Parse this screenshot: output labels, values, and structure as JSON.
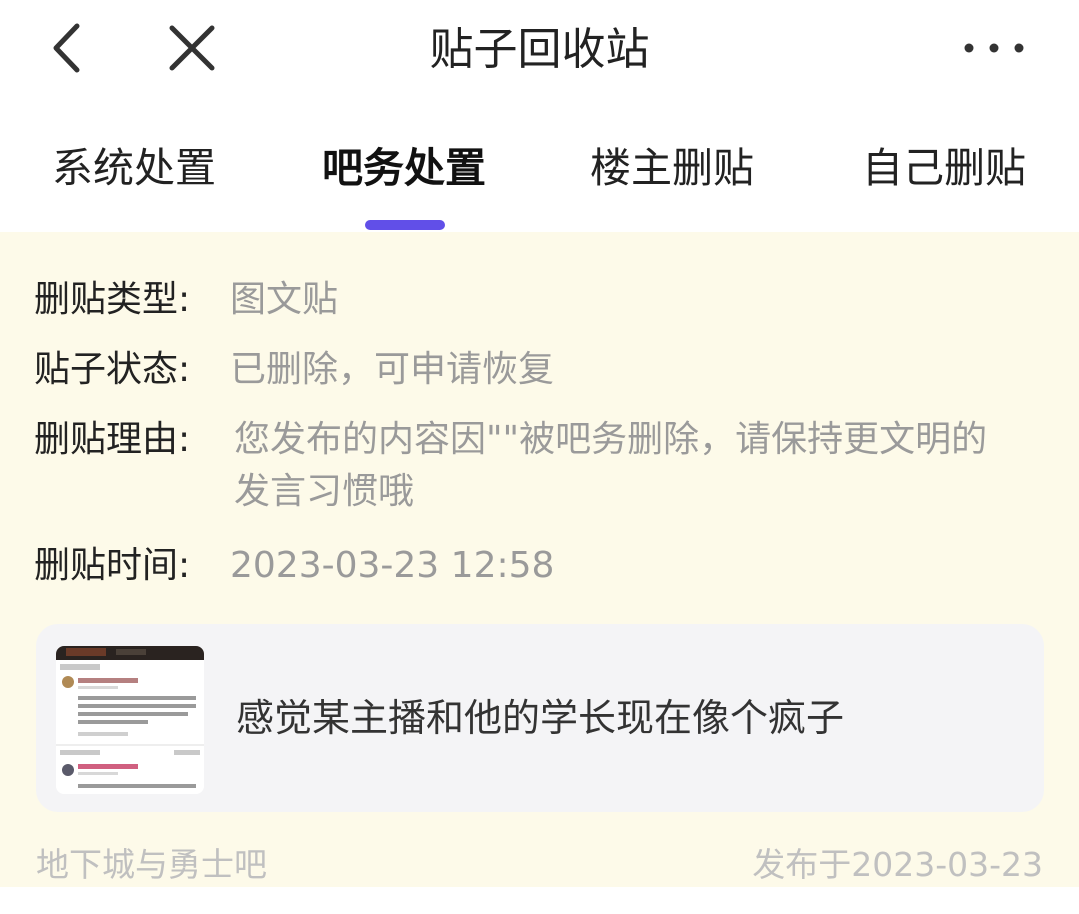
{
  "header": {
    "title": "贴子回收站",
    "back_icon": "chevron-left-icon",
    "close_icon": "close-icon",
    "more_icon": "more-dots-icon"
  },
  "tabs": [
    {
      "label": "系统处置"
    },
    {
      "label": "吧务处置"
    },
    {
      "label": "楼主删贴"
    },
    {
      "label": "自己删贴"
    }
  ],
  "active_tab": "吧务处置",
  "accent_color": "#614fe8",
  "details": {
    "type_label": "删贴类型:",
    "type_value": "图文贴",
    "status_label": "贴子状态:",
    "status_value": "已删除，可申请恢复",
    "reason_label": "删贴理由:",
    "reason_value": "您发布的内容因\"\"被吧务删除，请保持更文明的发言习惯哦",
    "time_label": "删贴时间:",
    "time_value": "2023-03-23 12:58"
  },
  "post": {
    "title": "感觉某主播和他的学长现在像个疯子",
    "forum": "地下城与勇士吧",
    "published": "发布于2023-03-23"
  }
}
